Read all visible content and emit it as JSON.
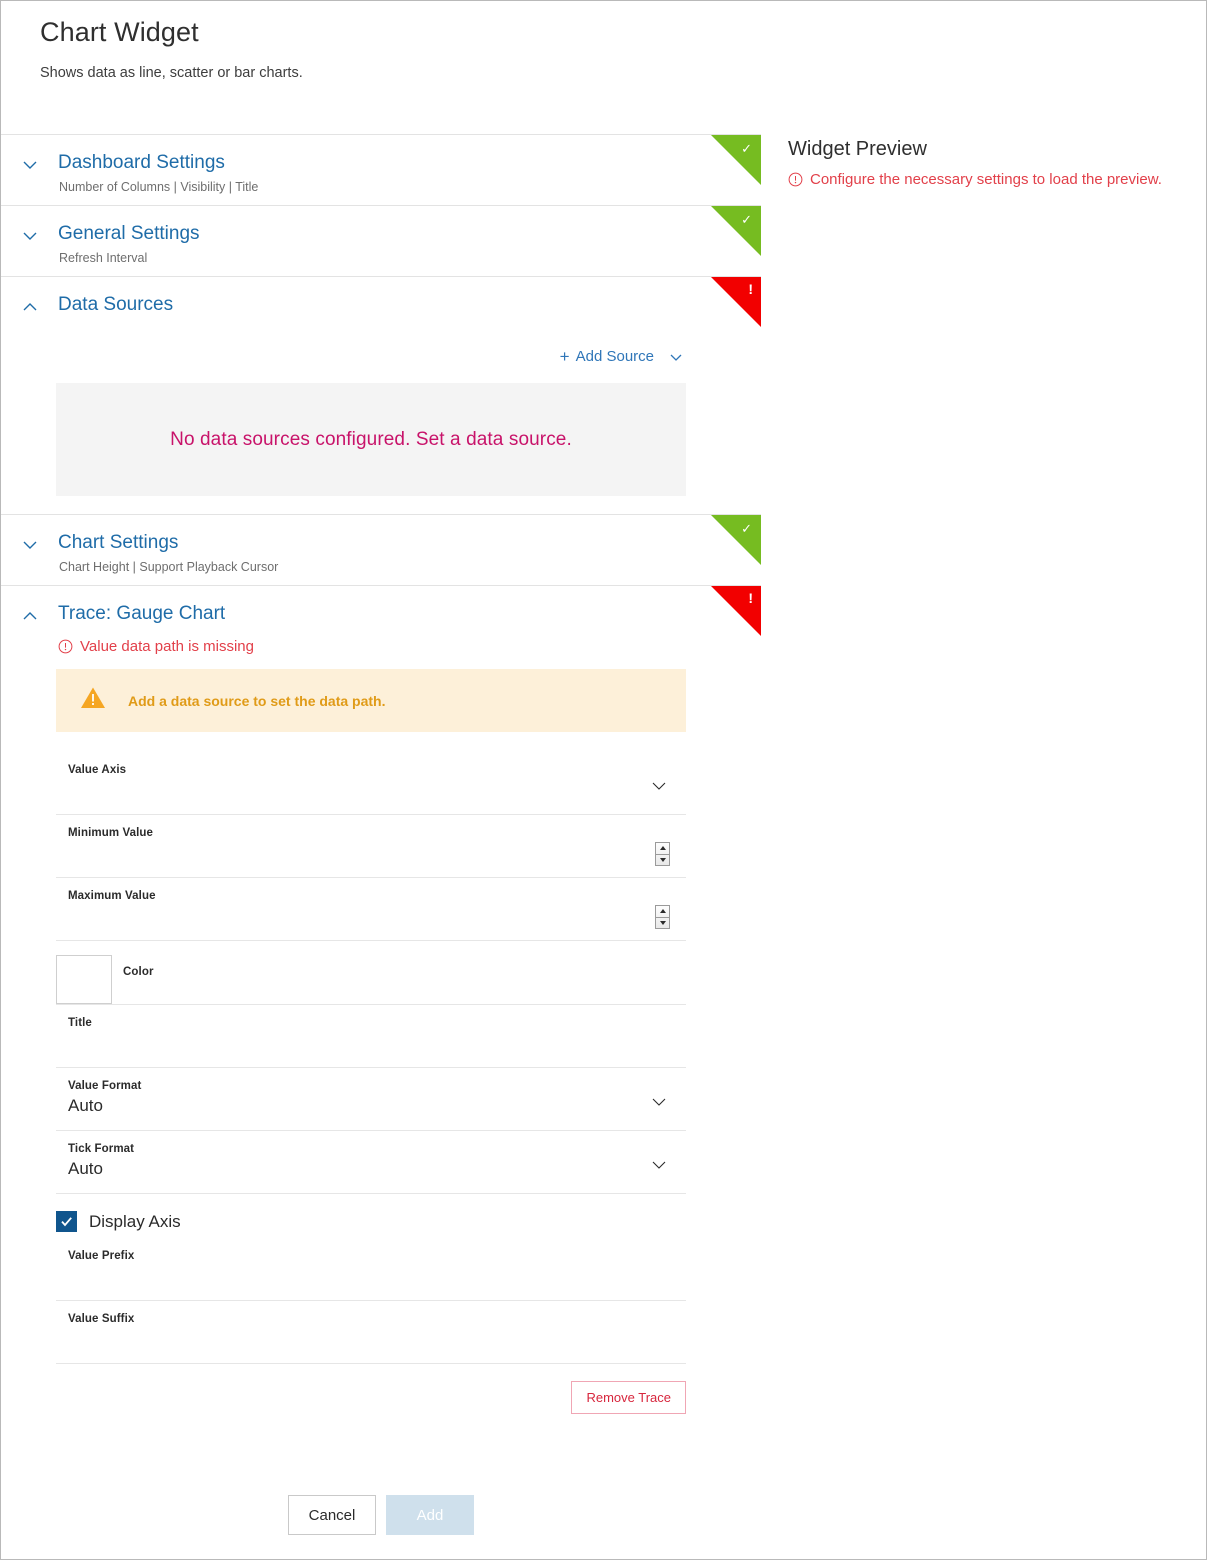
{
  "header": {
    "title": "Chart Widget",
    "subtitle": "Shows data as line, scatter or bar charts."
  },
  "sections": [
    {
      "title": "Dashboard Settings",
      "subtitle": "Number of Columns | Visibility | Title",
      "status": "ok",
      "expanded": false
    },
    {
      "title": "General Settings",
      "subtitle": "Refresh Interval",
      "status": "ok",
      "expanded": false
    },
    {
      "title": "Data Sources",
      "subtitle": "",
      "status": "error",
      "expanded": true
    },
    {
      "title": "Chart Settings",
      "subtitle": "Chart Height | Support Playback Cursor",
      "status": "ok",
      "expanded": false
    },
    {
      "title": "Trace: Gauge Chart",
      "subtitle": "",
      "status": "error",
      "expanded": true
    }
  ],
  "data_sources": {
    "add_source_label": "Add Source",
    "add_source_plus": "+",
    "empty_message": "No data sources configured. Set a data source."
  },
  "trace": {
    "error_text": "Value data path is missing",
    "warning_text": "Add a data source to set the data path.",
    "fields": [
      {
        "label": "Value Axis",
        "value": "",
        "control": "dropdown"
      },
      {
        "label": "Minimum Value",
        "value": "",
        "control": "spinner"
      },
      {
        "label": "Maximum Value",
        "value": "",
        "control": "spinner"
      },
      {
        "label": "Color",
        "value": "",
        "control": "color",
        "swatch": "#ffffff"
      },
      {
        "label": "Title",
        "value": "",
        "control": "text"
      },
      {
        "label": "Value Format",
        "value": "Auto",
        "control": "dropdown"
      },
      {
        "label": "Tick Format",
        "value": "Auto",
        "control": "dropdown"
      }
    ],
    "display_axis": {
      "label": "Display Axis",
      "checked": true
    },
    "fields_after": [
      {
        "label": "Value Prefix",
        "value": "",
        "control": "text"
      },
      {
        "label": "Value Suffix",
        "value": "",
        "control": "text"
      }
    ],
    "remove_label": "Remove Trace"
  },
  "footer": {
    "cancel_label": "Cancel",
    "add_label": "Add"
  },
  "preview": {
    "title": "Widget Preview",
    "message": "Configure the necessary settings to load the preview."
  },
  "colors": {
    "accent_blue": "#1f6ca8",
    "status_ok": "#76bc21",
    "status_error": "#f20000",
    "error_text": "#e2404a",
    "magenta": "#c8136a",
    "warn_bg": "#fdf0d9",
    "warn_text": "#e09b18",
    "checkbox": "#10558d",
    "remove_border": "#f0a6b4",
    "add_disabled": "#cfe0ec"
  }
}
